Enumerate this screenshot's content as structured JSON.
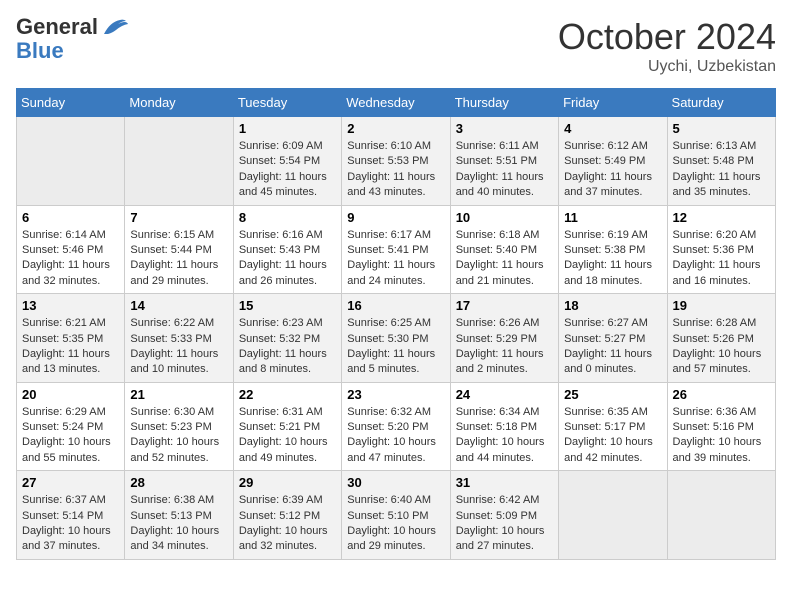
{
  "header": {
    "logo_general": "General",
    "logo_blue": "Blue",
    "month_title": "October 2024",
    "location": "Uychi, Uzbekistan"
  },
  "weekdays": [
    "Sunday",
    "Monday",
    "Tuesday",
    "Wednesday",
    "Thursday",
    "Friday",
    "Saturday"
  ],
  "weeks": [
    [
      {
        "day": "",
        "sunrise": "",
        "sunset": "",
        "daylight": ""
      },
      {
        "day": "",
        "sunrise": "",
        "sunset": "",
        "daylight": ""
      },
      {
        "day": "1",
        "sunrise": "Sunrise: 6:09 AM",
        "sunset": "Sunset: 5:54 PM",
        "daylight": "Daylight: 11 hours and 45 minutes."
      },
      {
        "day": "2",
        "sunrise": "Sunrise: 6:10 AM",
        "sunset": "Sunset: 5:53 PM",
        "daylight": "Daylight: 11 hours and 43 minutes."
      },
      {
        "day": "3",
        "sunrise": "Sunrise: 6:11 AM",
        "sunset": "Sunset: 5:51 PM",
        "daylight": "Daylight: 11 hours and 40 minutes."
      },
      {
        "day": "4",
        "sunrise": "Sunrise: 6:12 AM",
        "sunset": "Sunset: 5:49 PM",
        "daylight": "Daylight: 11 hours and 37 minutes."
      },
      {
        "day": "5",
        "sunrise": "Sunrise: 6:13 AM",
        "sunset": "Sunset: 5:48 PM",
        "daylight": "Daylight: 11 hours and 35 minutes."
      }
    ],
    [
      {
        "day": "6",
        "sunrise": "Sunrise: 6:14 AM",
        "sunset": "Sunset: 5:46 PM",
        "daylight": "Daylight: 11 hours and 32 minutes."
      },
      {
        "day": "7",
        "sunrise": "Sunrise: 6:15 AM",
        "sunset": "Sunset: 5:44 PM",
        "daylight": "Daylight: 11 hours and 29 minutes."
      },
      {
        "day": "8",
        "sunrise": "Sunrise: 6:16 AM",
        "sunset": "Sunset: 5:43 PM",
        "daylight": "Daylight: 11 hours and 26 minutes."
      },
      {
        "day": "9",
        "sunrise": "Sunrise: 6:17 AM",
        "sunset": "Sunset: 5:41 PM",
        "daylight": "Daylight: 11 hours and 24 minutes."
      },
      {
        "day": "10",
        "sunrise": "Sunrise: 6:18 AM",
        "sunset": "Sunset: 5:40 PM",
        "daylight": "Daylight: 11 hours and 21 minutes."
      },
      {
        "day": "11",
        "sunrise": "Sunrise: 6:19 AM",
        "sunset": "Sunset: 5:38 PM",
        "daylight": "Daylight: 11 hours and 18 minutes."
      },
      {
        "day": "12",
        "sunrise": "Sunrise: 6:20 AM",
        "sunset": "Sunset: 5:36 PM",
        "daylight": "Daylight: 11 hours and 16 minutes."
      }
    ],
    [
      {
        "day": "13",
        "sunrise": "Sunrise: 6:21 AM",
        "sunset": "Sunset: 5:35 PM",
        "daylight": "Daylight: 11 hours and 13 minutes."
      },
      {
        "day": "14",
        "sunrise": "Sunrise: 6:22 AM",
        "sunset": "Sunset: 5:33 PM",
        "daylight": "Daylight: 11 hours and 10 minutes."
      },
      {
        "day": "15",
        "sunrise": "Sunrise: 6:23 AM",
        "sunset": "Sunset: 5:32 PM",
        "daylight": "Daylight: 11 hours and 8 minutes."
      },
      {
        "day": "16",
        "sunrise": "Sunrise: 6:25 AM",
        "sunset": "Sunset: 5:30 PM",
        "daylight": "Daylight: 11 hours and 5 minutes."
      },
      {
        "day": "17",
        "sunrise": "Sunrise: 6:26 AM",
        "sunset": "Sunset: 5:29 PM",
        "daylight": "Daylight: 11 hours and 2 minutes."
      },
      {
        "day": "18",
        "sunrise": "Sunrise: 6:27 AM",
        "sunset": "Sunset: 5:27 PM",
        "daylight": "Daylight: 11 hours and 0 minutes."
      },
      {
        "day": "19",
        "sunrise": "Sunrise: 6:28 AM",
        "sunset": "Sunset: 5:26 PM",
        "daylight": "Daylight: 10 hours and 57 minutes."
      }
    ],
    [
      {
        "day": "20",
        "sunrise": "Sunrise: 6:29 AM",
        "sunset": "Sunset: 5:24 PM",
        "daylight": "Daylight: 10 hours and 55 minutes."
      },
      {
        "day": "21",
        "sunrise": "Sunrise: 6:30 AM",
        "sunset": "Sunset: 5:23 PM",
        "daylight": "Daylight: 10 hours and 52 minutes."
      },
      {
        "day": "22",
        "sunrise": "Sunrise: 6:31 AM",
        "sunset": "Sunset: 5:21 PM",
        "daylight": "Daylight: 10 hours and 49 minutes."
      },
      {
        "day": "23",
        "sunrise": "Sunrise: 6:32 AM",
        "sunset": "Sunset: 5:20 PM",
        "daylight": "Daylight: 10 hours and 47 minutes."
      },
      {
        "day": "24",
        "sunrise": "Sunrise: 6:34 AM",
        "sunset": "Sunset: 5:18 PM",
        "daylight": "Daylight: 10 hours and 44 minutes."
      },
      {
        "day": "25",
        "sunrise": "Sunrise: 6:35 AM",
        "sunset": "Sunset: 5:17 PM",
        "daylight": "Daylight: 10 hours and 42 minutes."
      },
      {
        "day": "26",
        "sunrise": "Sunrise: 6:36 AM",
        "sunset": "Sunset: 5:16 PM",
        "daylight": "Daylight: 10 hours and 39 minutes."
      }
    ],
    [
      {
        "day": "27",
        "sunrise": "Sunrise: 6:37 AM",
        "sunset": "Sunset: 5:14 PM",
        "daylight": "Daylight: 10 hours and 37 minutes."
      },
      {
        "day": "28",
        "sunrise": "Sunrise: 6:38 AM",
        "sunset": "Sunset: 5:13 PM",
        "daylight": "Daylight: 10 hours and 34 minutes."
      },
      {
        "day": "29",
        "sunrise": "Sunrise: 6:39 AM",
        "sunset": "Sunset: 5:12 PM",
        "daylight": "Daylight: 10 hours and 32 minutes."
      },
      {
        "day": "30",
        "sunrise": "Sunrise: 6:40 AM",
        "sunset": "Sunset: 5:10 PM",
        "daylight": "Daylight: 10 hours and 29 minutes."
      },
      {
        "day": "31",
        "sunrise": "Sunrise: 6:42 AM",
        "sunset": "Sunset: 5:09 PM",
        "daylight": "Daylight: 10 hours and 27 minutes."
      },
      {
        "day": "",
        "sunrise": "",
        "sunset": "",
        "daylight": ""
      },
      {
        "day": "",
        "sunrise": "",
        "sunset": "",
        "daylight": ""
      }
    ]
  ]
}
